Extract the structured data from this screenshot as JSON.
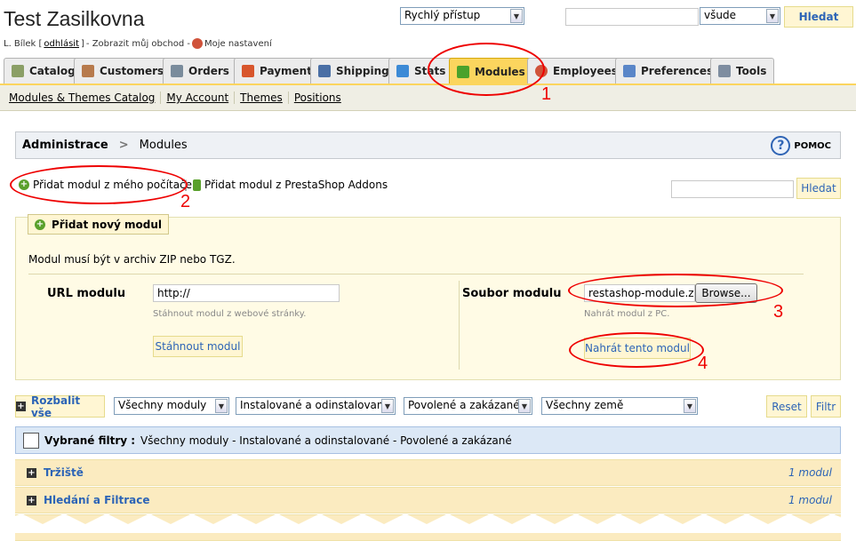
{
  "header": {
    "shop_title": "Test Zasilkovna",
    "quick_access": "Rychlý přístup",
    "search_scope": "všude",
    "search_button": "Hledat"
  },
  "userbar": {
    "name": "L. Bílek [",
    "logout": "odhlásit",
    "close": "]",
    "show_shop": "- Zobrazit můj obchod -",
    "my_settings": "Moje nastavení"
  },
  "tabs": [
    {
      "label": "Catalog",
      "icon": "catalog-icon",
      "color": "#8b9f66"
    },
    {
      "label": "Customers",
      "icon": "customers-icon",
      "color": "#b77a4c"
    },
    {
      "label": "Orders",
      "icon": "orders-icon",
      "color": "#7a8c9c"
    },
    {
      "label": "Payment",
      "icon": "payment-icon",
      "color": "#d8562c"
    },
    {
      "label": "Shipping",
      "icon": "shipping-icon",
      "color": "#4a6fa5"
    },
    {
      "label": "Stats",
      "icon": "stats-icon",
      "color": "#3c8ad6"
    },
    {
      "label": "Modules",
      "icon": "puzzle-icon",
      "color": "#4aa22c"
    },
    {
      "label": "Employees",
      "icon": "employees-icon",
      "color": "#d0533b"
    },
    {
      "label": "Preferences",
      "icon": "preferences-icon",
      "color": "#5a86c8"
    },
    {
      "label": "Tools",
      "icon": "tools-icon",
      "color": "#7e8da0"
    }
  ],
  "subnav": [
    "Modules & Themes Catalog",
    "My Account",
    "Themes",
    "Positions"
  ],
  "breadcrumb": {
    "root": "Administrace",
    "sep": ">",
    "current": "Modules",
    "help": "POMOC"
  },
  "links": {
    "from_computer": "Přidat modul z mého počítače",
    "sep": "|",
    "from_addons": "Přidat modul z PrestaShop Addons",
    "search_button": "Hledat"
  },
  "panel": {
    "title": "Přidat nový modul",
    "note": "Modul musí být v archiv ZIP nebo TGZ.",
    "url_label": "URL modulu",
    "url_value": "http://",
    "url_hint": "Stáhnout modul z webové stránky.",
    "download_button": "Stáhnout modul",
    "file_label": "Soubor modulu",
    "file_value": "restashop-module.zip",
    "browse_button": "Browse...",
    "file_hint": "Nahrát modul z PC.",
    "upload_button": "Nahrát tento modul"
  },
  "filters": {
    "expand_all": "Rozbalit vše",
    "modules": "Všechny moduly",
    "installed": "Instalované a odinstalované",
    "enabled": "Povolené a zakázané",
    "countries": "Všechny země",
    "reset": "Reset",
    "filter": "Filtr",
    "selected_label": "Vybrané filtry :",
    "selected_value": "Všechny moduly - Instalované a odinstalované - Povolené a zakázané"
  },
  "categories": [
    {
      "name": "Tržiště",
      "count": "1 modul"
    },
    {
      "name": "Hledání a Filtrace",
      "count": "1 modul"
    }
  ],
  "annotations": [
    "1",
    "2",
    "3",
    "4"
  ],
  "annotation_color": "#e00000"
}
